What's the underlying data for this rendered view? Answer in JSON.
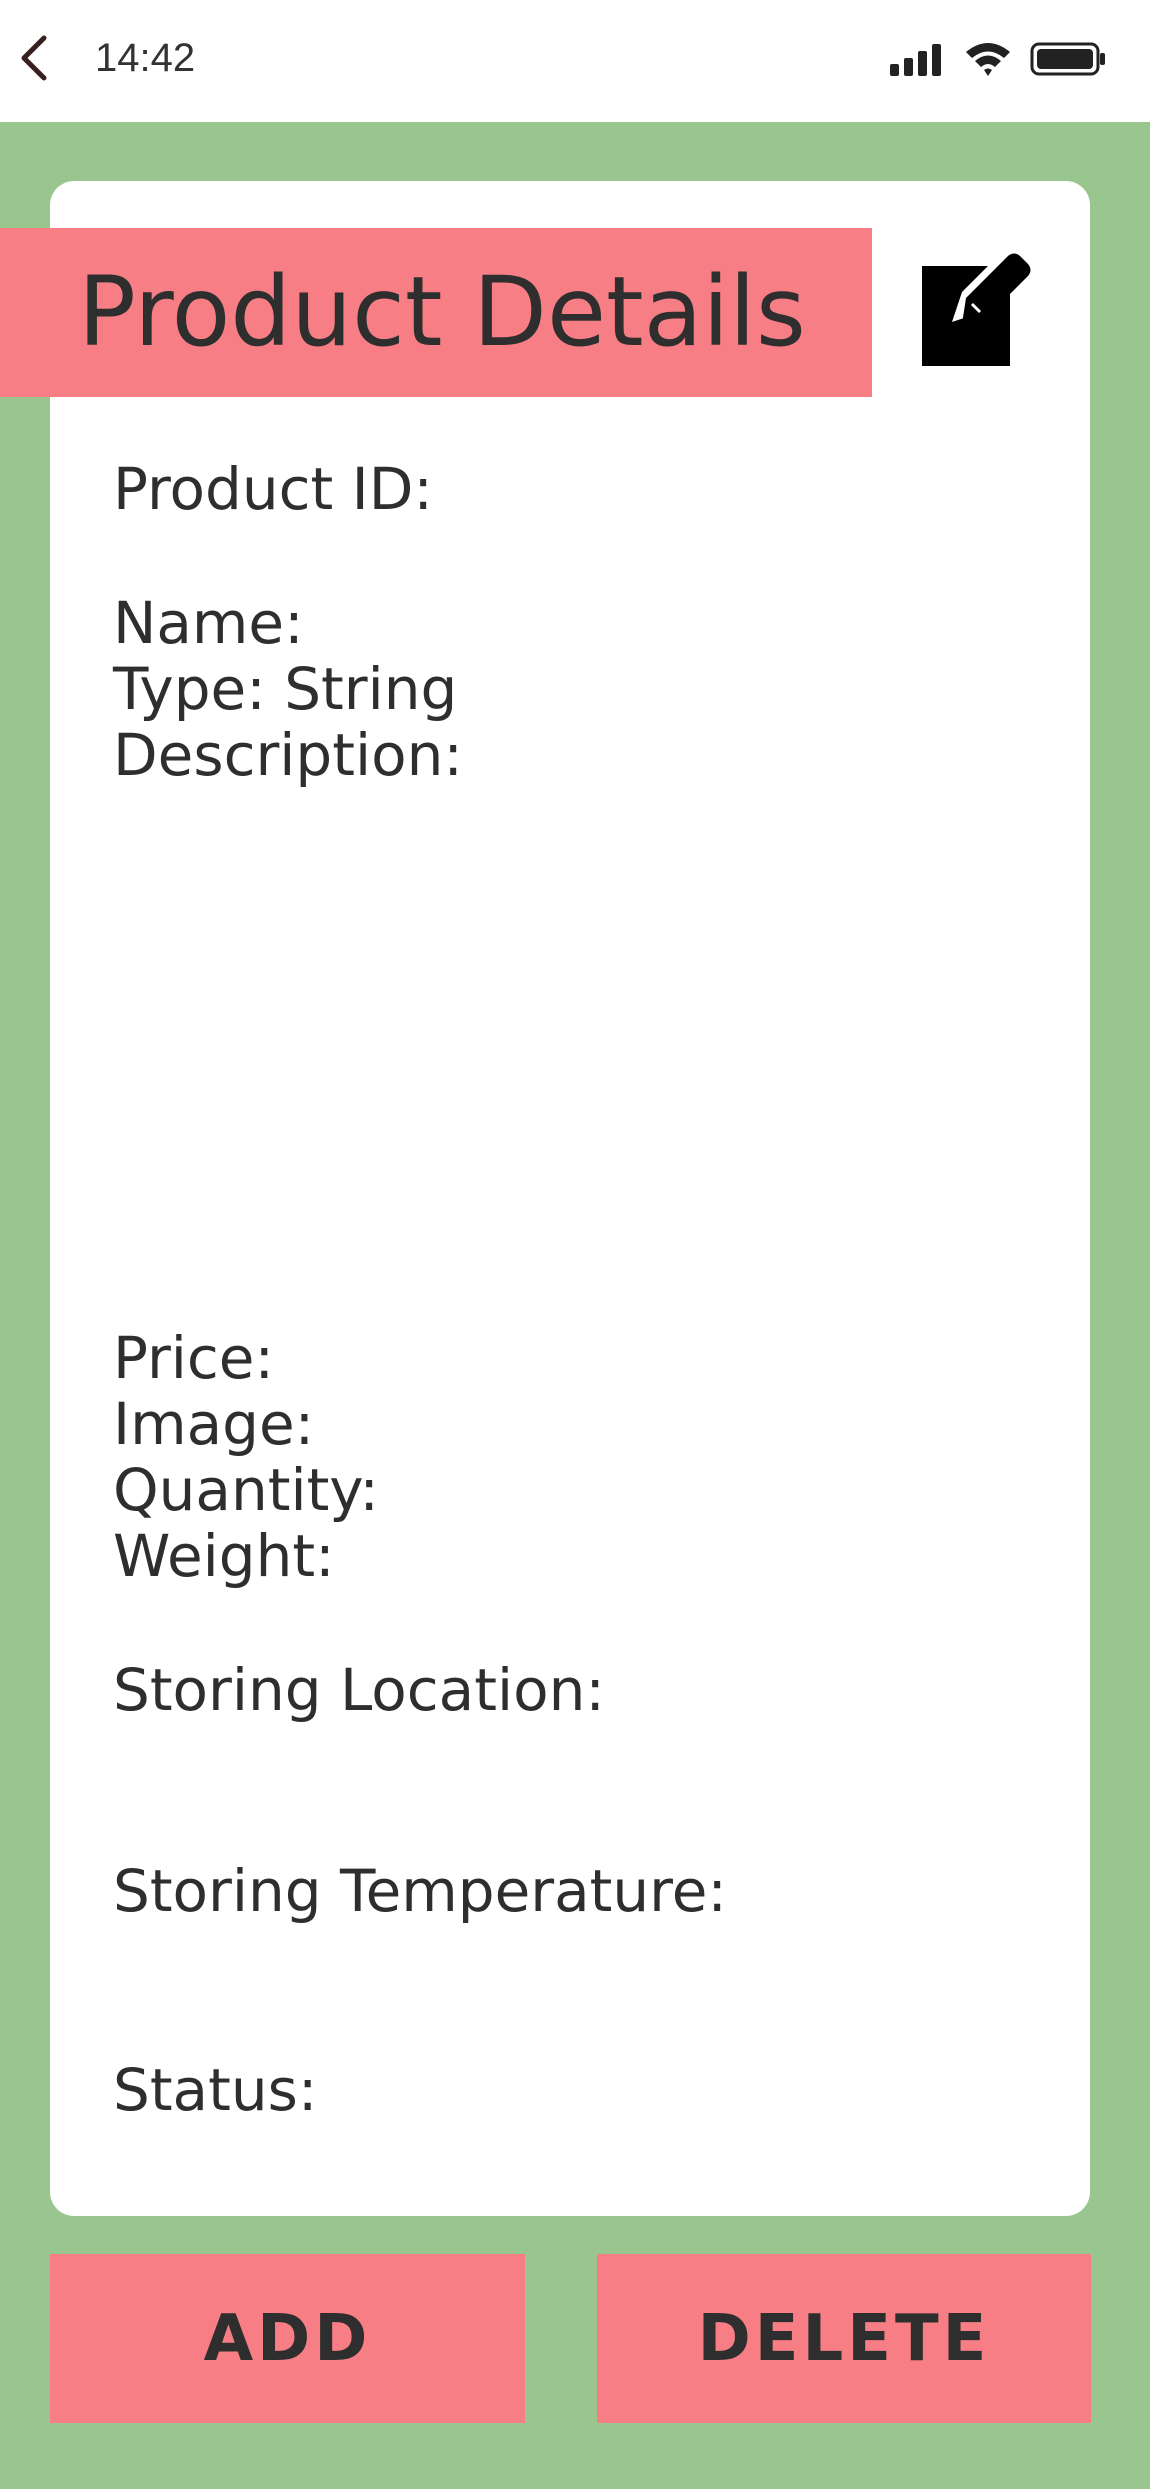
{
  "status_bar": {
    "time": "14:42",
    "icons": [
      "back-arrow-icon",
      "signal-icon",
      "wifi-icon",
      "battery-icon"
    ]
  },
  "header": {
    "title": "Product Details",
    "edit_icon": "edit-icon"
  },
  "fields": {
    "product_id": "Product ID:",
    "name": "Name:",
    "type": "Type: String",
    "description": "Description:",
    "price": "Price:",
    "image": "Image:",
    "quantity": "Quantity:",
    "weight": "Weight:",
    "storing_location": "Storing Location:",
    "storing_temperature": "Storing Temperature:",
    "status": "Status:"
  },
  "actions": {
    "add_label": "ADD",
    "delete_label": "DELETE"
  },
  "colors": {
    "background": "#99C68E",
    "accent": "#F77E84",
    "card": "#FFFFFF",
    "text": "#2E2E2E"
  }
}
